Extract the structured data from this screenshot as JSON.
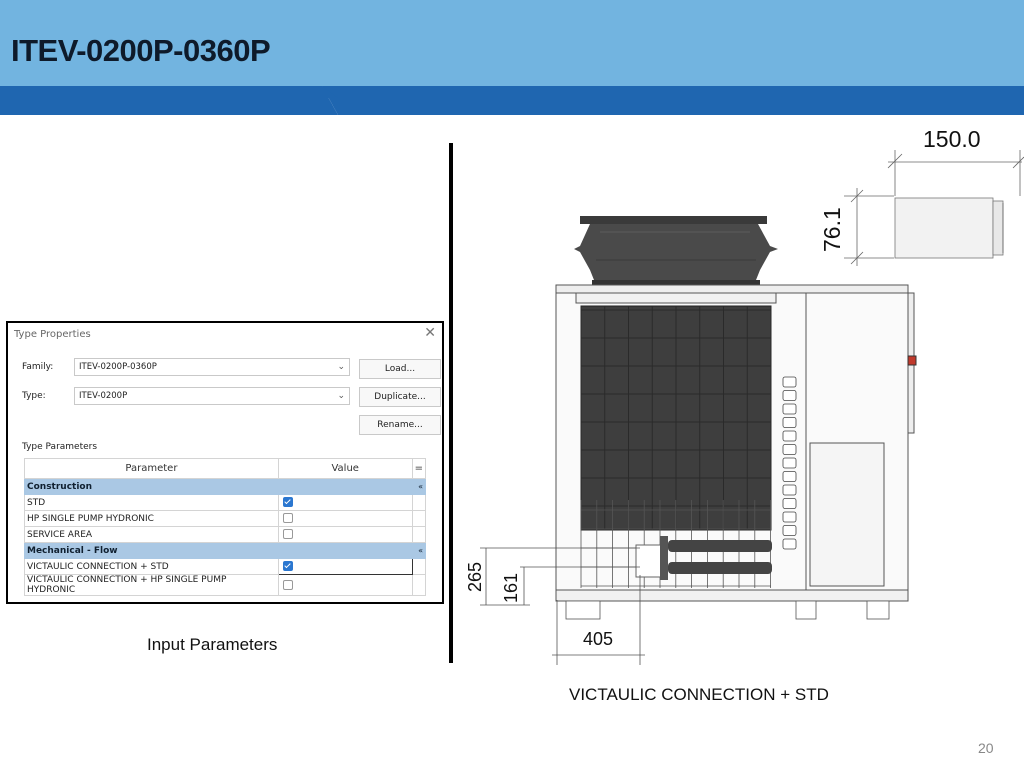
{
  "colors": {
    "header_light": "#72b4e0",
    "header_dark": "#1f66b0",
    "group_row": "#aac8e4",
    "checkbox_on": "#2b77d0"
  },
  "slide": {
    "title": "ITEV-0200P-0360P",
    "page_number": "20"
  },
  "dialog": {
    "title": "Type Properties",
    "close_icon": "close-icon",
    "family_label": "Family:",
    "family_value": "ITEV-0200P-0360P",
    "type_label": "Type:",
    "type_value": "ITEV-0200P",
    "load_button": "Load...",
    "duplicate_button": "Duplicate...",
    "rename_button": "Rename...",
    "type_parameters_label": "Type Parameters",
    "col_parameter": "Parameter",
    "col_value": "Value",
    "col_extra": "=",
    "groups": [
      {
        "name": "Construction",
        "collapse": "«",
        "rows": [
          {
            "label": "STD",
            "checked": true
          },
          {
            "label": "HP SINGLE PUMP HYDRONIC",
            "checked": false
          },
          {
            "label": "SERVICE AREA",
            "checked": false
          }
        ]
      },
      {
        "name": "Mechanical - Flow",
        "collapse": "«",
        "rows": [
          {
            "label": "VICTAULIC CONNECTION + STD",
            "checked": true
          },
          {
            "label": "VICTAULIC CONNECTION + HP SINGLE PUMP HYDRONIC",
            "checked": false
          }
        ]
      }
    ]
  },
  "captions": {
    "left": "Input Parameters",
    "right": "VICTAULIC CONNECTION + STD"
  },
  "drawing": {
    "dim_pipe_length": "150.0",
    "dim_pipe_diameter": "76.1",
    "dim_height_upper": "265",
    "dim_height_lower": "161",
    "dim_width": "405"
  }
}
